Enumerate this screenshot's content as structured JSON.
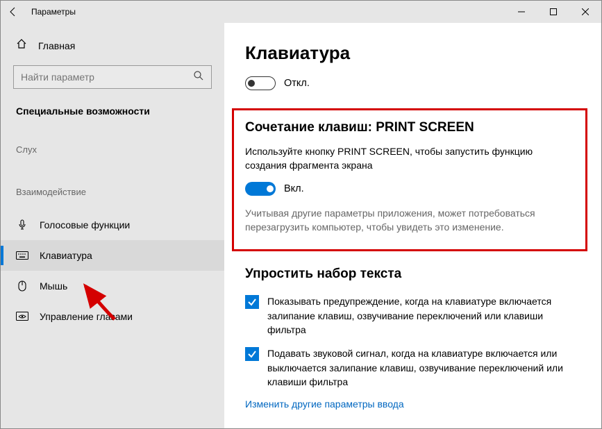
{
  "titlebar": {
    "title": "Параметры"
  },
  "sidebar": {
    "home": "Главная",
    "search_placeholder": "Найти параметр",
    "category": "Специальные возможности",
    "group_hearing": "Слух",
    "group_interaction": "Взаимодействие",
    "items": {
      "speech": "Голосовые функции",
      "keyboard": "Клавиатура",
      "mouse": "Мышь",
      "eye": "Управление глазами"
    }
  },
  "main": {
    "title": "Клавиатура",
    "toggle1_label": "Откл.",
    "section_print": {
      "heading": "Сочетание клавиш: PRINT SCREEN",
      "desc": "Используйте кнопку PRINT SCREEN, чтобы запустить функцию создания фрагмента экрана",
      "toggle_label": "Вкл.",
      "note": "Учитывая другие параметры приложения, может потребоваться перезагрузить компьютер, чтобы увидеть это изменение."
    },
    "section_simplify": {
      "heading": "Упростить набор текста",
      "check1": "Показывать предупреждение, когда на клавиатуре включается залипание клавиш, озвучивание переключений или клавиши фильтра",
      "check2": "Подавать звуковой сигнал, когда на клавиатуре включается или выключается залипание клавиш, озвучивание переключений или клавиши фильтра",
      "link": "Изменить другие параметры ввода"
    }
  }
}
